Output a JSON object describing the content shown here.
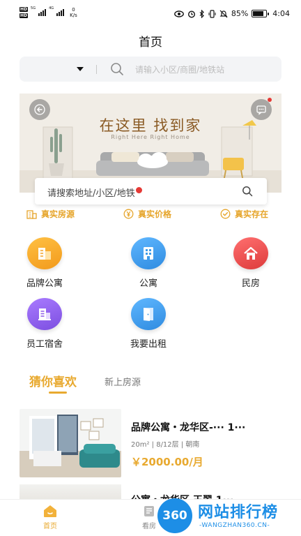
{
  "status_bar": {
    "sim1": "HD",
    "sim2": "HD",
    "net1": "5G",
    "net2": "4G",
    "speed_value": "0",
    "speed_unit": "K/s",
    "battery": "85%",
    "time": "4:04"
  },
  "header": {
    "title": "首页"
  },
  "search": {
    "placeholder": "请输入小区/商圈/地铁站"
  },
  "banner": {
    "title": "在这里 找到家",
    "subtitle": "Right Here Right Home"
  },
  "address_search": {
    "text": "请搜索地址/小区/地铁"
  },
  "guarantees": [
    {
      "label": "真实房源",
      "icon": "building-icon"
    },
    {
      "label": "真实价格",
      "icon": "yen-circle-icon"
    },
    {
      "label": "真实存在",
      "icon": "check-circle-icon"
    }
  ],
  "categories": [
    {
      "label": "品牌公寓",
      "icon": "brand-apartment-icon",
      "color": "#f5a623"
    },
    {
      "label": "公寓",
      "icon": "apartment-icon",
      "color": "#3d9be9"
    },
    {
      "label": "民房",
      "icon": "house-icon",
      "color": "#e94b4b"
    },
    {
      "label": "员工宿舍",
      "icon": "dormitory-icon",
      "color": "#8e5be8"
    },
    {
      "label": "我要出租",
      "icon": "door-icon",
      "color": "#3d9be9"
    }
  ],
  "tabs": {
    "active": "猜你喜欢",
    "other": "新上房源"
  },
  "listings": [
    {
      "title": "品牌公寓・龙华区-··· 1···",
      "meta": "20m² | 8/12层 | 朝南",
      "price": "￥2000.00/月"
    },
    {
      "title": "公寓・龙华区 王翠 1···"
    }
  ],
  "bottom_nav": {
    "home": "首页",
    "browse": "看房"
  },
  "watermark": {
    "badge": "360",
    "text": "网站排行榜",
    "url": "-WANGZHAN360.CN-"
  },
  "colors": {
    "accent": "#e8a92f",
    "search_bg": "#f3f4f6",
    "watermark": "#1d8ee6"
  }
}
